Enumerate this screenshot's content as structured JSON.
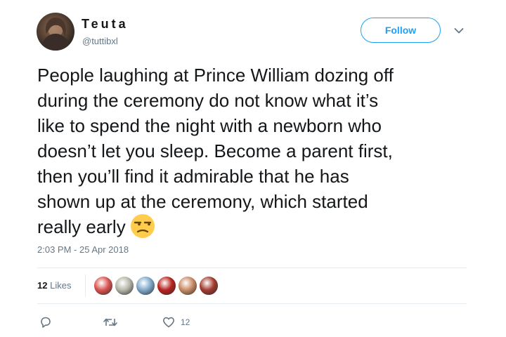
{
  "user": {
    "display_name": "Teuta",
    "handle": "@tuttibxl"
  },
  "header": {
    "follow_label": "Follow"
  },
  "tweet": {
    "lines": [
      "People laughing at Prince William dozing off",
      "during the ceremony do not know what it’s",
      "like to spend the night with a newborn who",
      "doesn’t let you sleep. Become a parent first,",
      "then you’ll find it admirable that he has",
      "shown up at the ceremony, which started",
      "really early"
    ],
    "emoji": "unamused-face",
    "timestamp": "2:03 PM - 25 Apr 2018"
  },
  "stats": {
    "likes_count": "12",
    "likes_label": "Likes"
  },
  "likers": [
    {
      "name": "liker-1",
      "color": "#d9534f"
    },
    {
      "name": "liker-2",
      "color": "#b5b5a8"
    },
    {
      "name": "liker-3",
      "color": "#7fa8c9"
    },
    {
      "name": "liker-4",
      "color": "#b8231f"
    },
    {
      "name": "liker-5",
      "color": "#c88a63"
    },
    {
      "name": "liker-6",
      "color": "#a33b2f"
    }
  ],
  "actions": {
    "reply_icon": "reply-icon",
    "retweet_icon": "retweet-icon",
    "like_icon": "heart-icon",
    "like_count": "12"
  },
  "colors": {
    "accent": "#1da1f2",
    "secondary_text": "#657786",
    "divider": "#e6ecf0"
  }
}
